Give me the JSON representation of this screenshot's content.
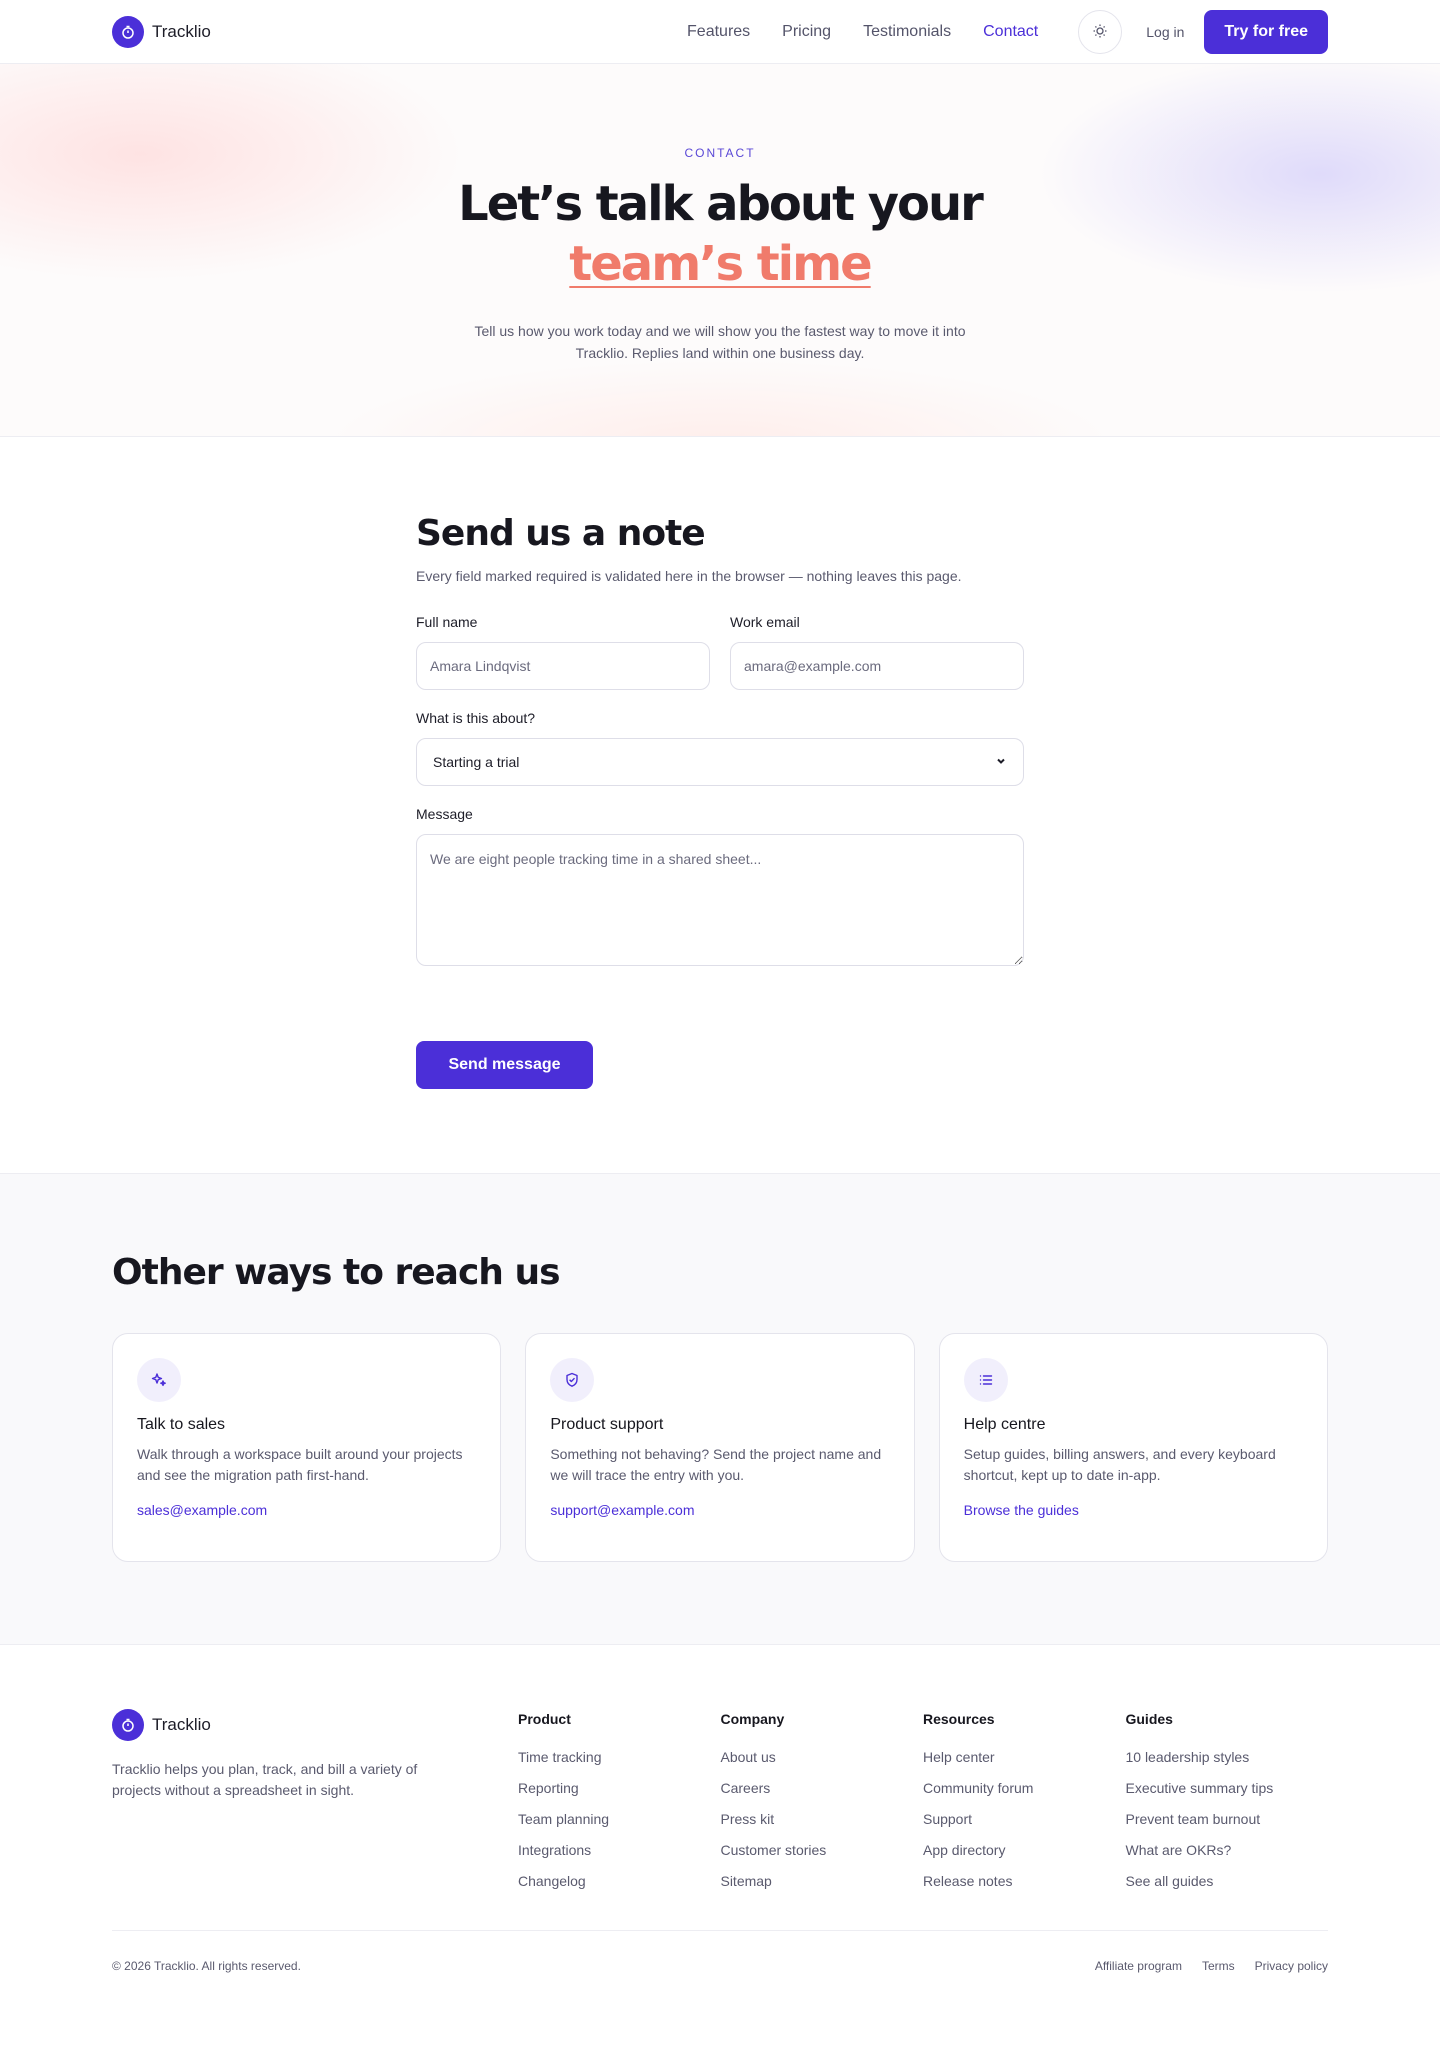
{
  "header": {
    "brand": "Tracklio",
    "nav": [
      {
        "label": "Features"
      },
      {
        "label": "Pricing"
      },
      {
        "label": "Testimonials"
      },
      {
        "label": "Contact"
      }
    ],
    "login_label": "Log in",
    "cta_label": "Try for free"
  },
  "hero": {
    "eyebrow": "CONTACT",
    "title_main": "Let’s talk about your ",
    "title_accent": "team’s time",
    "subtitle": "Tell us how you work today and we will show you the fastest way to move it into Tracklio. Replies land within one business day."
  },
  "form": {
    "title": "Send us a note",
    "lead": "Every field marked required is validated here in the browser — nothing leaves this page.",
    "name_label": "Full name",
    "name_placeholder": "Amara Lindqvist",
    "email_label": "Work email",
    "email_placeholder": "amara@example.com",
    "topic_label": "What is this about?",
    "topic_value": "Starting a trial",
    "message_label": "Message",
    "message_placeholder": "We are eight people tracking time in a shared sheet...",
    "submit_label": "Send message"
  },
  "other": {
    "title": "Other ways to reach us",
    "cards": [
      {
        "title": "Talk to sales",
        "text": "Walk through a workspace built around your projects and see the migration path first-hand.",
        "link": "sales@example.com"
      },
      {
        "title": "Product support",
        "text": "Something not behaving? Send the project name and we will trace the entry with you.",
        "link": "support@example.com"
      },
      {
        "title": "Help centre",
        "text": "Setup guides, billing answers, and every keyboard shortcut, kept up to date in-app.",
        "link": "Browse the guides"
      }
    ]
  },
  "footer": {
    "brand": "Tracklio",
    "description": "Tracklio helps you plan, track, and bill a variety of projects without a spreadsheet in sight.",
    "columns": [
      {
        "title": "Product",
        "items": [
          "Time tracking",
          "Reporting",
          "Team planning",
          "Integrations",
          "Changelog"
        ]
      },
      {
        "title": "Company",
        "items": [
          "About us",
          "Careers",
          "Press kit",
          "Customer stories",
          "Sitemap"
        ]
      },
      {
        "title": "Resources",
        "items": [
          "Help center",
          "Community forum",
          "Support",
          "App directory",
          "Release notes"
        ]
      },
      {
        "title": "Guides",
        "items": [
          "10 leadership styles",
          "Executive summary tips",
          "Prevent team burnout",
          "What are OKRs?",
          "See all guides"
        ]
      }
    ],
    "copyright": "© 2026 Tracklio. All rights reserved.",
    "legal": [
      "Affiliate program",
      "Terms",
      "Privacy policy"
    ]
  },
  "colors": {
    "brand": "#4b2fd8",
    "accent": "#f07b6b",
    "text": "#17171f",
    "muted": "#5a5a6e"
  },
  "icons": {
    "brand": "stopwatch-icon",
    "theme": "sun-icon",
    "sales": "sparkle-icon",
    "support": "shield-check-icon",
    "help": "list-icon",
    "select": "chevron-down-icon"
  }
}
